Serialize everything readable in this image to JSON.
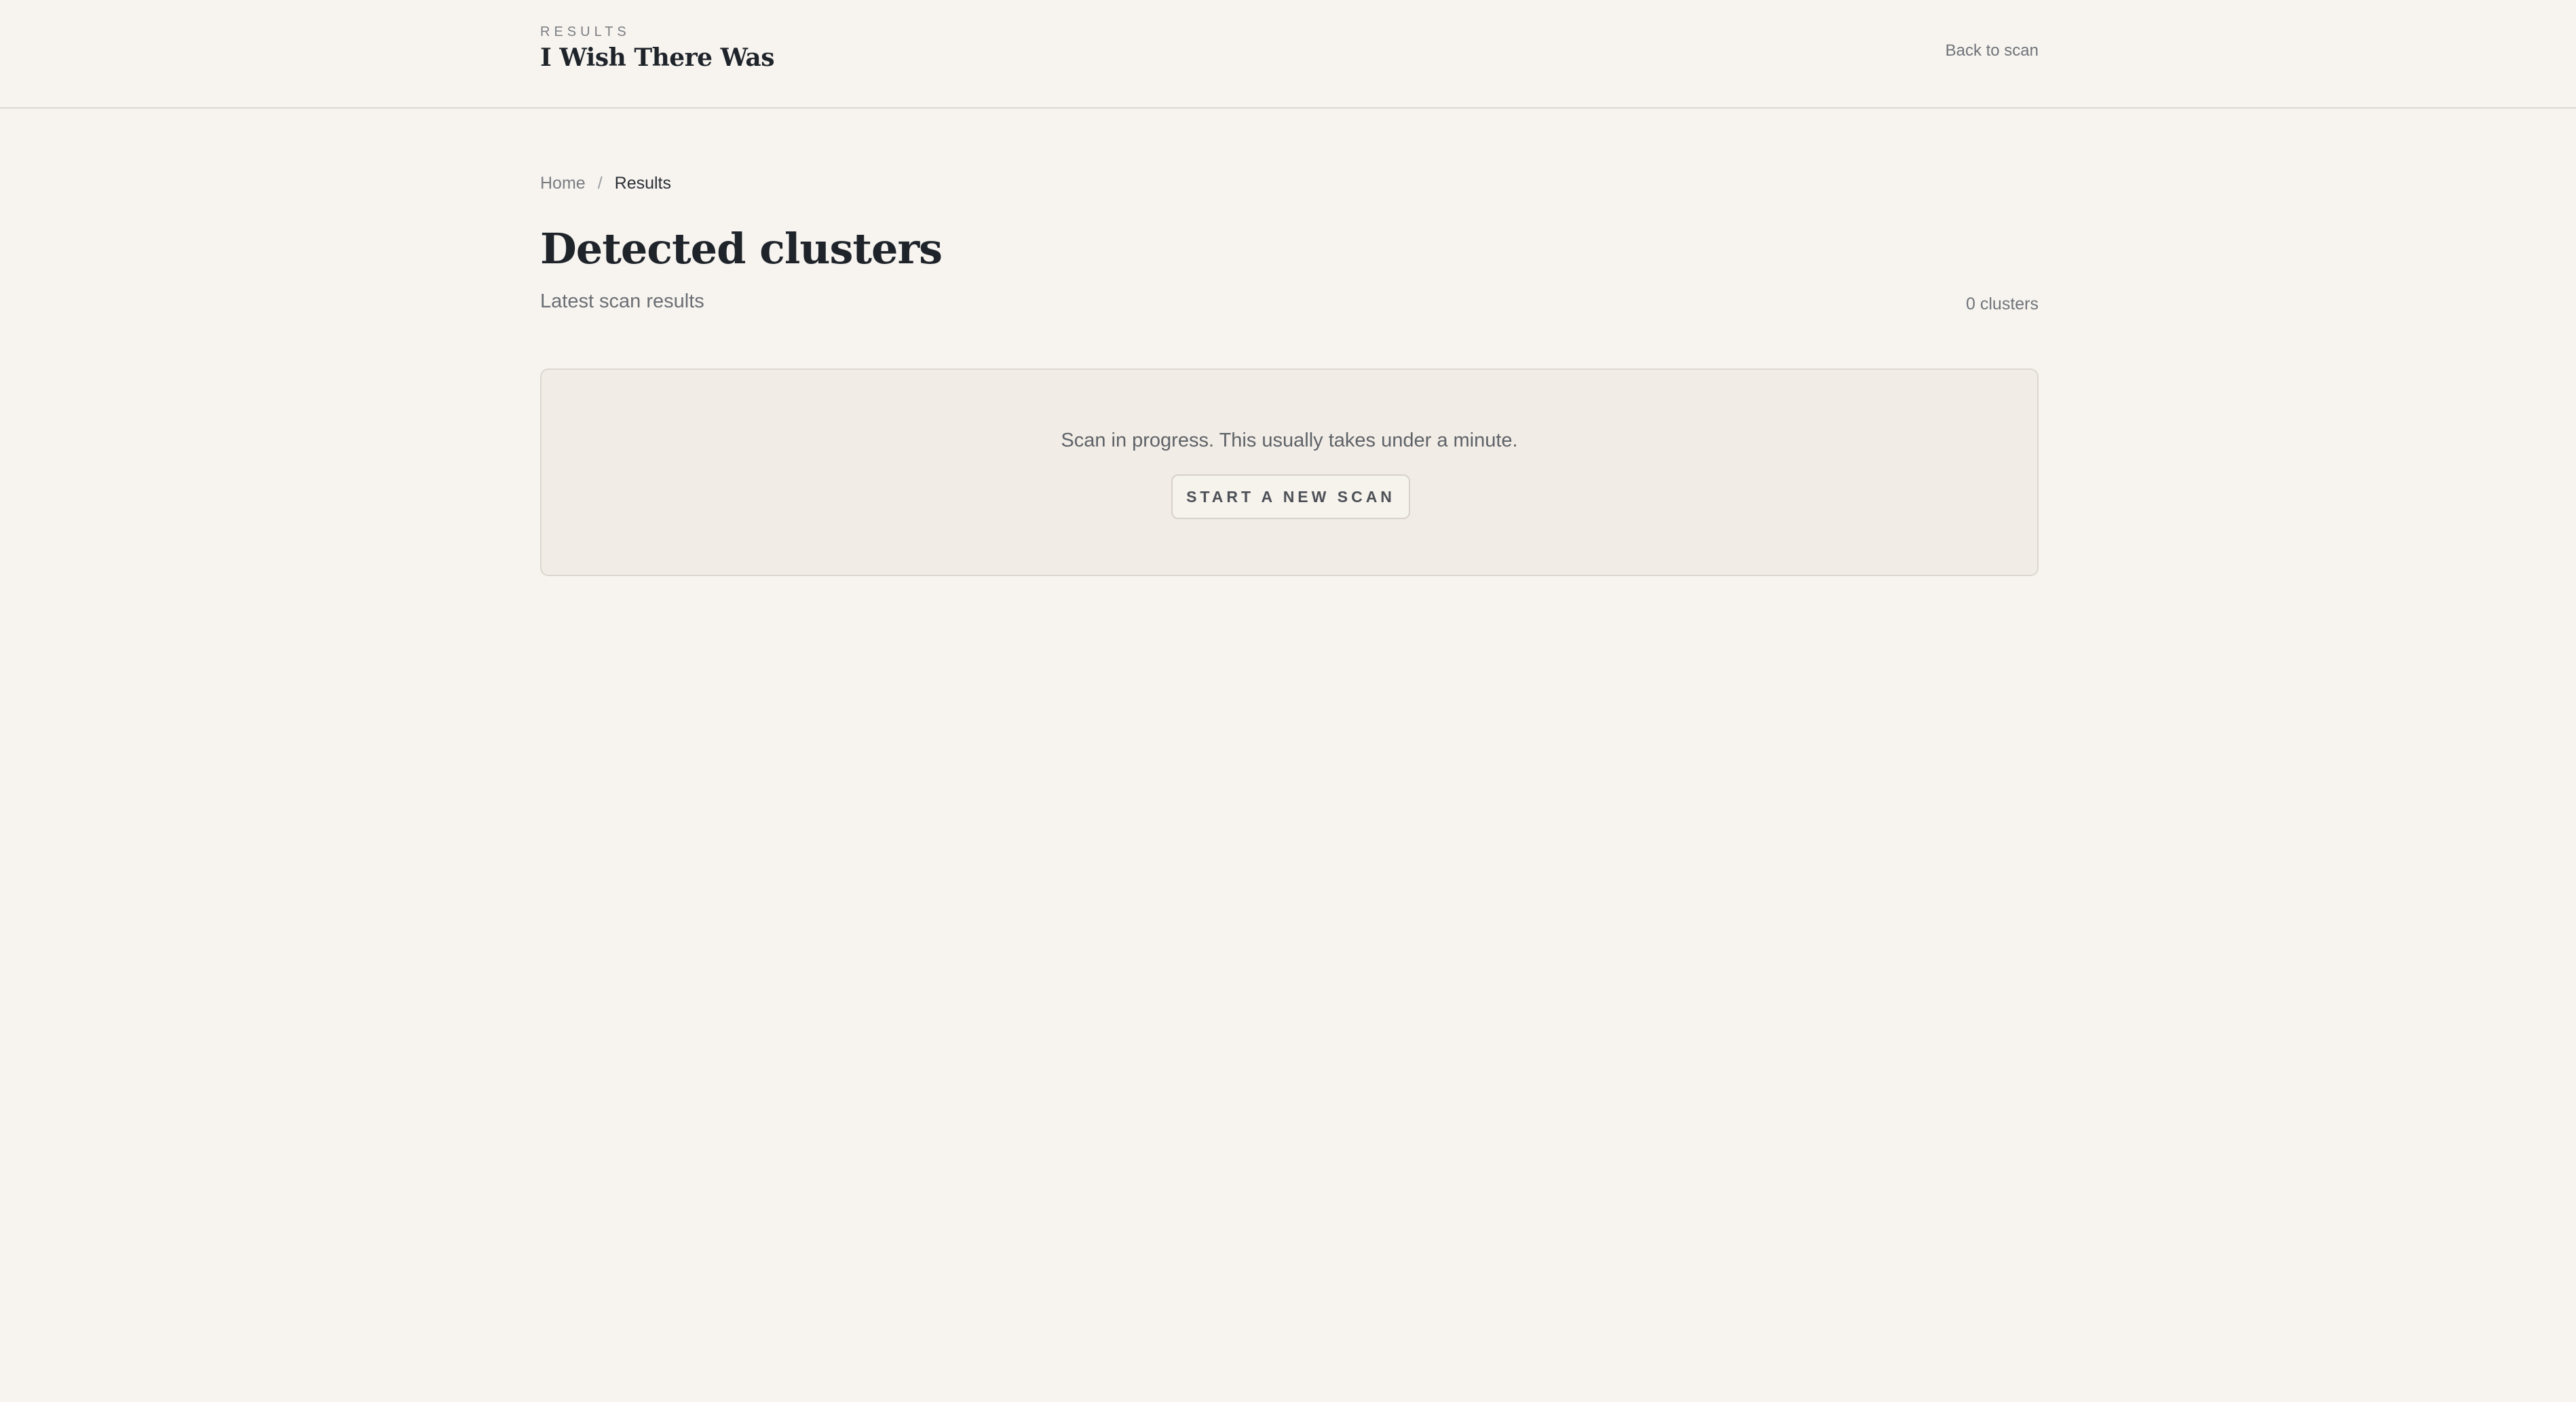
{
  "header": {
    "kicker": "RESULTS",
    "title": "I Wish There Was",
    "back_link": "Back to scan"
  },
  "breadcrumb": {
    "home": "Home",
    "separator": "/",
    "current": "Results"
  },
  "main": {
    "title": "Detected clusters",
    "subtitle": "Latest scan results",
    "cluster_count": "0 clusters"
  },
  "scan_panel": {
    "message": "Scan in progress. This usually takes under a minute.",
    "button_label": "START A NEW SCAN"
  },
  "colors": {
    "background": "#f7f4ef",
    "panel": "#f1ece6",
    "border": "#dcd7cf",
    "text_dark": "#1f242b",
    "text_muted": "#6f7379"
  }
}
